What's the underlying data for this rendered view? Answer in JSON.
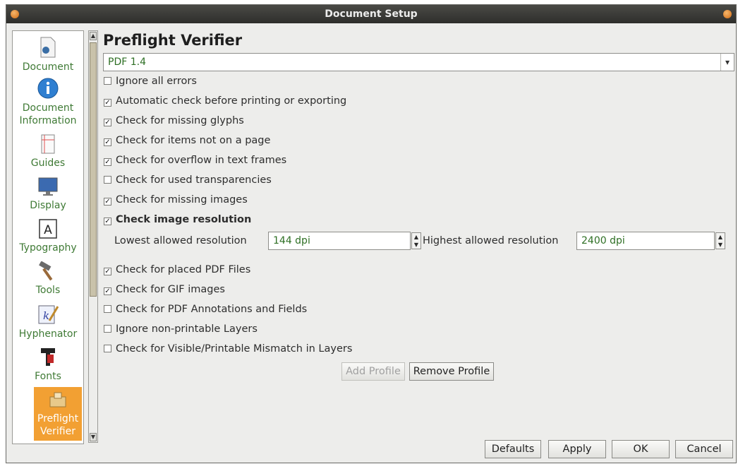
{
  "window": {
    "title": "Document Setup"
  },
  "sidebar": {
    "items": [
      {
        "label": "Document",
        "icon": "document-icon"
      },
      {
        "label": "Document Information",
        "icon": "info-icon"
      },
      {
        "label": "Guides",
        "icon": "guides-icon"
      },
      {
        "label": "Display",
        "icon": "display-icon"
      },
      {
        "label": "Typography",
        "icon": "typography-icon"
      },
      {
        "label": "Tools",
        "icon": "tools-icon"
      },
      {
        "label": "Hyphenator",
        "icon": "hyphenator-icon"
      },
      {
        "label": "Fonts",
        "icon": "fonts-icon"
      },
      {
        "label": "Preflight Verifier",
        "icon": "preflight-icon",
        "active": true
      }
    ]
  },
  "main": {
    "heading": "Preflight Verifier",
    "profile": "PDF 1.4",
    "checks": [
      {
        "label": "Ignore all errors",
        "checked": false
      },
      {
        "label": "Automatic check before printing or exporting",
        "checked": true
      },
      {
        "label": "Check for missing glyphs",
        "checked": true
      },
      {
        "label": "Check for items not on a page",
        "checked": true
      },
      {
        "label": "Check for overflow in text frames",
        "checked": true
      },
      {
        "label": "Check for used transparencies",
        "checked": false
      },
      {
        "label": "Check for missing images",
        "checked": true
      },
      {
        "label": "Check image resolution",
        "checked": true
      },
      {
        "label": "Check for placed PDF Files",
        "checked": true
      },
      {
        "label": "Check for GIF images",
        "checked": true
      },
      {
        "label": "Check for PDF Annotations and Fields",
        "checked": false
      },
      {
        "label": "Ignore non-printable Layers",
        "checked": false
      },
      {
        "label": "Check for Visible/Printable Mismatch in Layers",
        "checked": false
      }
    ],
    "resolution": {
      "lowest_label": "Lowest allowed resolution",
      "lowest_value": "144 dpi",
      "highest_label": "Highest allowed resolution",
      "highest_value": "2400 dpi"
    },
    "add_profile": "Add Profile",
    "remove_profile": "Remove Profile"
  },
  "footer": {
    "defaults": "Defaults",
    "apply": "Apply",
    "ok": "OK",
    "cancel": "Cancel"
  },
  "colors": {
    "accent": "#f2a033",
    "label_green": "#3f7a35",
    "value_green": "#2e6f24"
  }
}
